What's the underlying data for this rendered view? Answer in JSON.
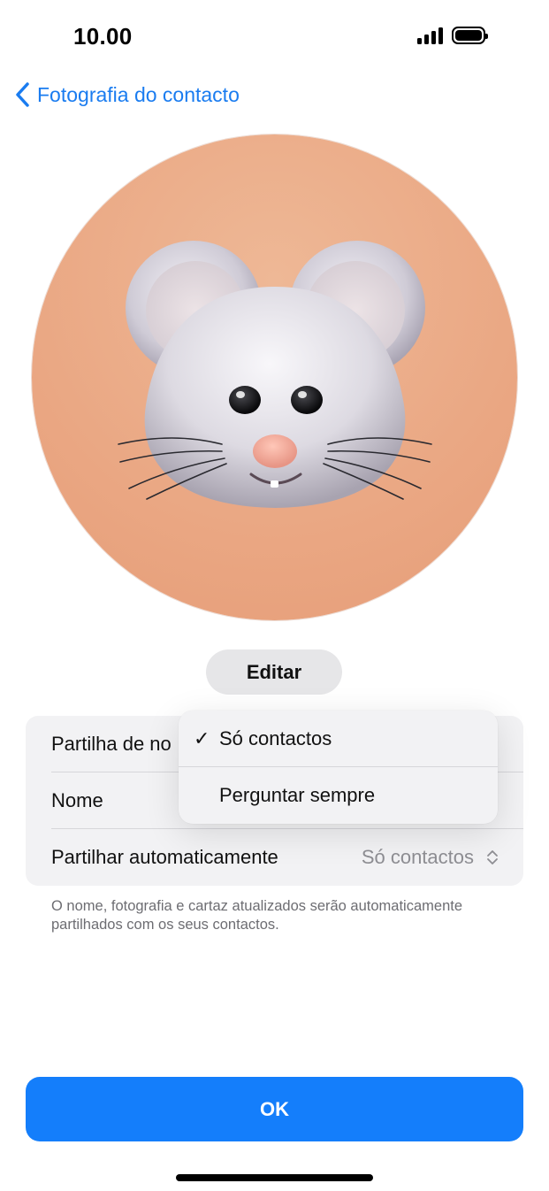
{
  "status_bar": {
    "time": "10.00",
    "icons": [
      "cellular-signal-icon",
      "battery-icon"
    ]
  },
  "nav": {
    "back_label": "Fotografia do contacto",
    "back_icon": "chevron-left-icon"
  },
  "avatar": {
    "description_icon": "mouse-memoji-icon",
    "background_color": "#eaa783"
  },
  "edit_button": {
    "label": "Editar"
  },
  "settings": {
    "rows": [
      {
        "label": "Partilha de no"
      },
      {
        "label": "Nome"
      },
      {
        "label": "Partilhar automaticamente",
        "value": "Só contactos"
      }
    ]
  },
  "menu": {
    "items": [
      {
        "label": "Só contactos",
        "checked": true,
        "check": "✓"
      },
      {
        "label": "Perguntar sempre",
        "checked": false
      }
    ]
  },
  "footnote": "O nome, fotografia e cartaz atualizados serão automaticamente partilhados com os seus contactos.",
  "ok_button": {
    "label": "OK"
  },
  "colors": {
    "accent": "#147efb",
    "link": "#1a7cf0",
    "group_bg": "#f2f2f4",
    "secondary_text": "#8e8e93"
  }
}
